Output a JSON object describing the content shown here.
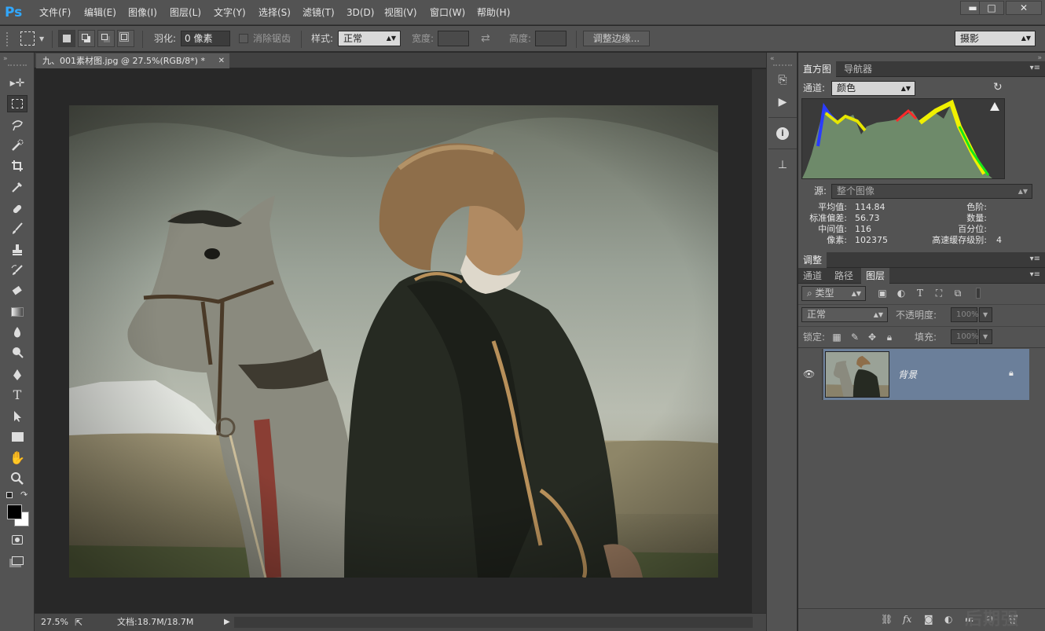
{
  "app": {
    "logo": "Ps"
  },
  "menu": [
    "文件(F)",
    "编辑(E)",
    "图像(I)",
    "图层(L)",
    "文字(Y)",
    "选择(S)",
    "滤镜(T)",
    "3D(D)",
    "视图(V)",
    "窗口(W)",
    "帮助(H)"
  ],
  "window_controls": {
    "minimize": "▬",
    "maximize": "□",
    "close": "✕"
  },
  "options": {
    "feather_label": "羽化:",
    "feather_value": "0 像素",
    "antialias_label": "消除锯齿",
    "style_label": "样式:",
    "style_value": "正常",
    "width_label": "宽度:",
    "height_label": "高度:",
    "refine_edge": "调整边缘...",
    "workspace": "摄影"
  },
  "document": {
    "tab_title": "九、001素材图.jpg @ 27.5%(RGB/8*) *",
    "zoom": "27.5%",
    "doc_size": "文档:18.7M/18.7M"
  },
  "histogram_panel": {
    "tabs": [
      "直方图",
      "导航器"
    ],
    "channel_label": "通道:",
    "channel_value": "颜色",
    "source_label": "源:",
    "source_value": "整个图像",
    "stats_left": [
      {
        "label": "平均值:",
        "value": "114.84"
      },
      {
        "label": "标准偏差:",
        "value": "56.73"
      },
      {
        "label": "中间值:",
        "value": "116"
      },
      {
        "label": "像素:",
        "value": "102375"
      }
    ],
    "stats_right": [
      {
        "label": "色阶:",
        "value": ""
      },
      {
        "label": "数量:",
        "value": ""
      },
      {
        "label": "百分位:",
        "value": ""
      },
      {
        "label": "高速缓存级别:",
        "value": "4"
      }
    ]
  },
  "adjust_panel": {
    "tab": "调整"
  },
  "layers_panel": {
    "tabs": [
      "通道",
      "路径",
      "图层"
    ],
    "filter_value": "类型",
    "blend_value": "正常",
    "opacity_label": "不透明度:",
    "opacity_value": "100%",
    "lock_label": "锁定:",
    "fill_label": "填充:",
    "fill_value": "100%",
    "layers": [
      {
        "name": "背景",
        "locked": true,
        "visible": true
      }
    ]
  },
  "watermark": "后期强",
  "colors": {
    "accent": "#31a8ff",
    "selected_layer": "#6b7f9a"
  }
}
